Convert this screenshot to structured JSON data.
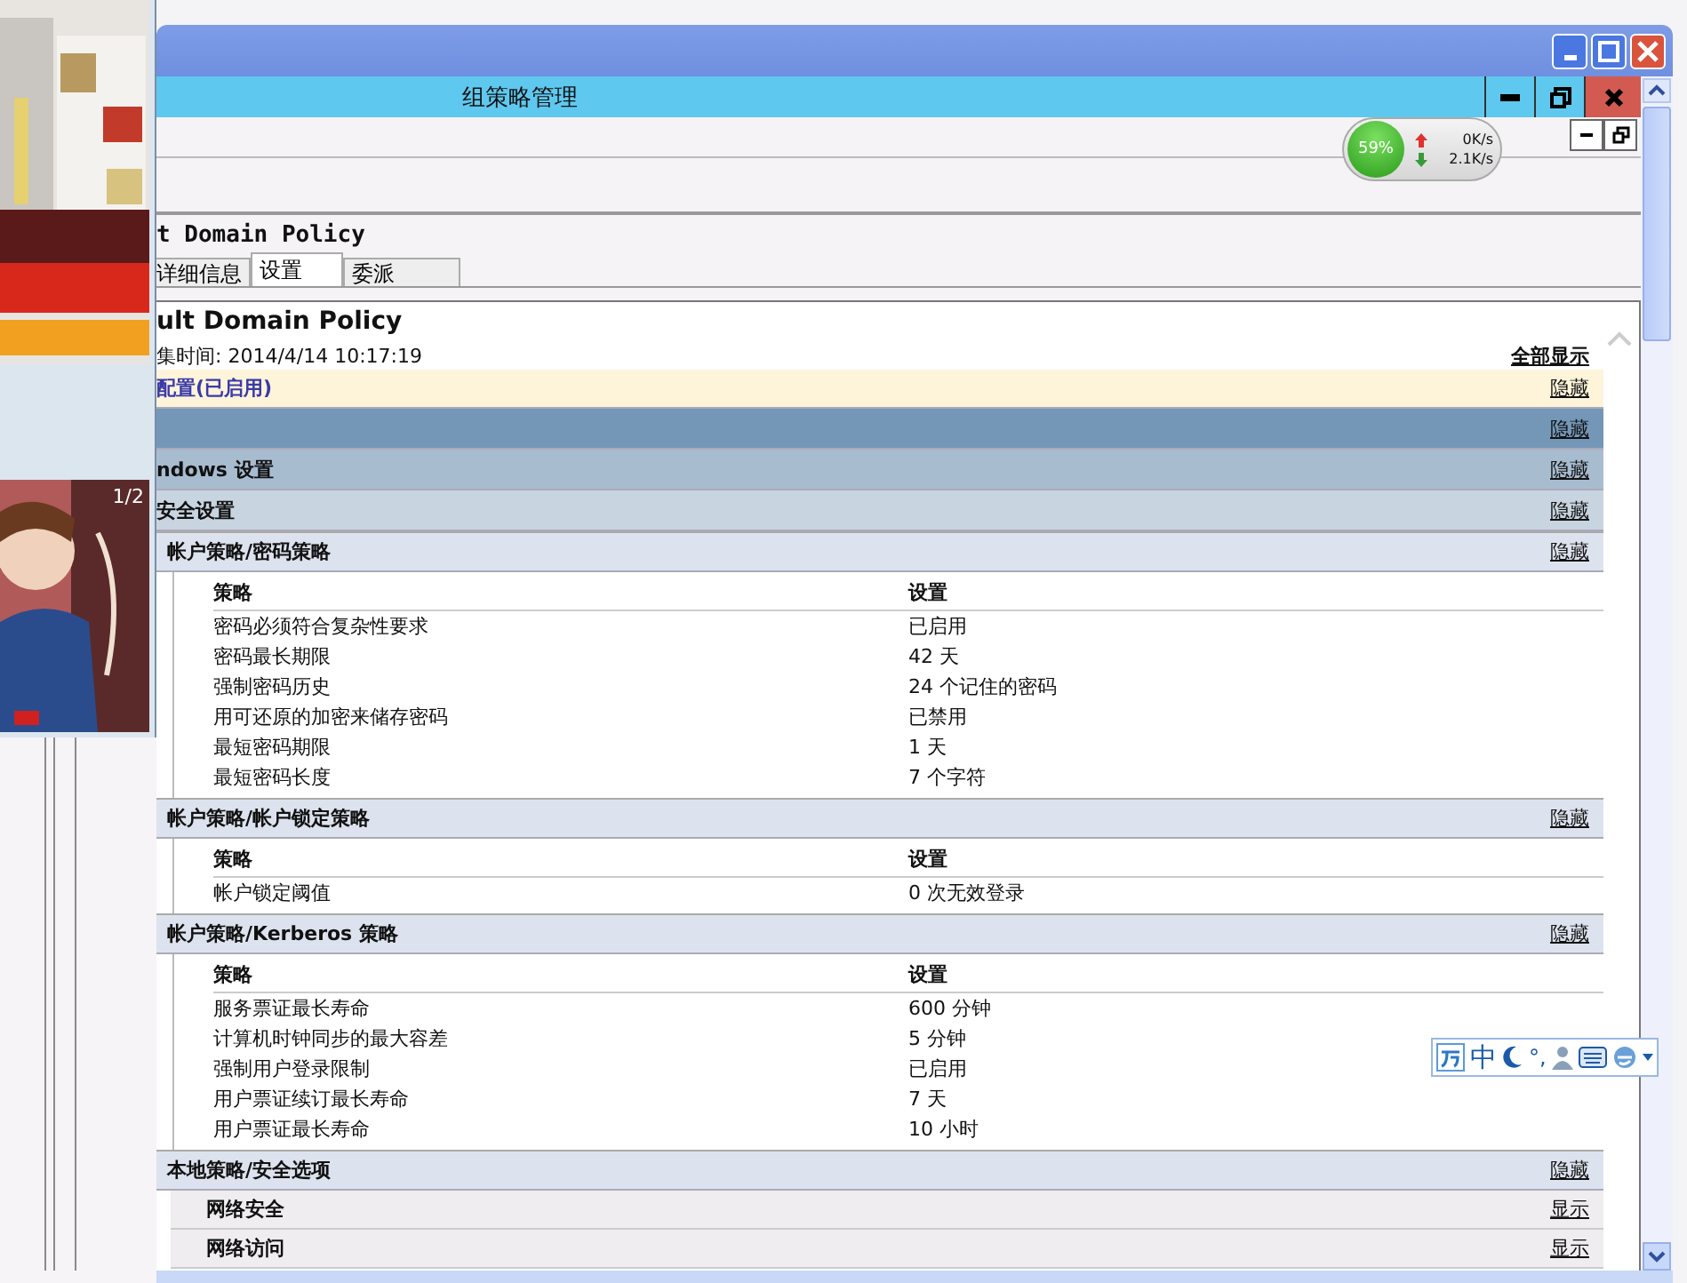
{
  "window": {
    "title": "组策略管理"
  },
  "network_meter": {
    "percent": "59%",
    "upload": "0K/s",
    "download": "2.1K/s"
  },
  "gpo_title": "t Domain Policy",
  "tabs": [
    {
      "label": "详细信息",
      "selected": false
    },
    {
      "label": "设置",
      "selected": true
    },
    {
      "label": "委派",
      "selected": false
    }
  ],
  "report": {
    "title": "ult Domain Policy",
    "time": "集时间: 2014/4/14 10:17:19",
    "show_all": "全部显示",
    "sections": [
      {
        "kind": "summary",
        "title": "配置(已启用)",
        "toggle": "隐藏"
      },
      {
        "kind": "level1",
        "toggle": "隐藏"
      },
      {
        "kind": "level2",
        "title": "ndows 设置",
        "toggle": "隐藏"
      },
      {
        "kind": "level3",
        "title": "安全设置",
        "toggle": "隐藏"
      },
      {
        "kind": "category",
        "title": "帐户策略/密码策略",
        "toggle": "隐藏",
        "columns": [
          "策略",
          "设置"
        ],
        "rows": [
          [
            "密码必须符合复杂性要求",
            "已启用"
          ],
          [
            "密码最长期限",
            "42 天"
          ],
          [
            "强制密码历史",
            "24 个记住的密码"
          ],
          [
            "用可还原的加密来储存密码",
            "已禁用"
          ],
          [
            "最短密码期限",
            "1 天"
          ],
          [
            "最短密码长度",
            "7 个字符"
          ]
        ]
      },
      {
        "kind": "category",
        "title": "帐户策略/帐户锁定策略",
        "toggle": "隐藏",
        "columns": [
          "策略",
          "设置"
        ],
        "rows": [
          [
            "帐户锁定阈值",
            "0 次无效登录"
          ]
        ]
      },
      {
        "kind": "category",
        "title": "帐户策略/Kerberos 策略",
        "toggle": "隐藏",
        "columns": [
          "策略",
          "设置"
        ],
        "rows": [
          [
            "服务票证最长寿命",
            "600 分钟"
          ],
          [
            "计算机时钟同步的最大容差",
            "5 分钟"
          ],
          [
            "强制用户登录限制",
            "已启用"
          ],
          [
            "用户票证续订最长寿命",
            "7 天"
          ],
          [
            "用户票证最长寿命",
            "10 小时"
          ]
        ]
      },
      {
        "kind": "category",
        "title": "本地策略/安全选项",
        "toggle": "隐藏"
      },
      {
        "kind": "subcategory",
        "title": "网络安全",
        "toggle": "显示"
      },
      {
        "kind": "subcategory",
        "title": "网络访问",
        "toggle": "显示"
      }
    ]
  },
  "ad": {
    "counter": "1/2"
  },
  "ime_bar": {
    "mode": "中",
    "punctuation": "°,"
  }
}
